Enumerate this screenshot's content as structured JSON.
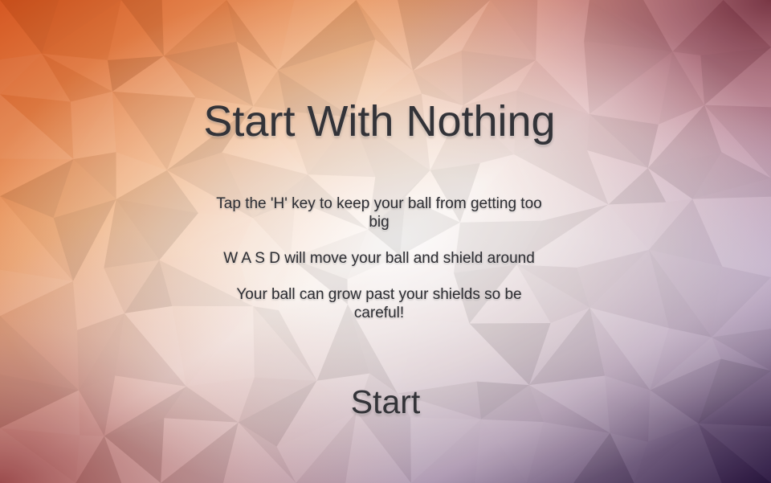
{
  "screen": {
    "title": "Start With Nothing",
    "instructions": [
      "Tap the 'H' key to keep your ball from getting too big",
      "W A S D will move your ball and shield around",
      "Your ball can grow past your shields so be careful!"
    ],
    "start_label": "Start"
  },
  "colors": {
    "text": "#333338",
    "background_center": "#f3ece8",
    "background_top_left": "#d4531c",
    "background_top_right": "#6a2030",
    "background_bottom_left": "#8a2a2c",
    "background_bottom_right": "#2a1640",
    "background_right_middle": "#c7b6d2"
  },
  "icons": {
    "background": "low-poly-gradient-background"
  }
}
